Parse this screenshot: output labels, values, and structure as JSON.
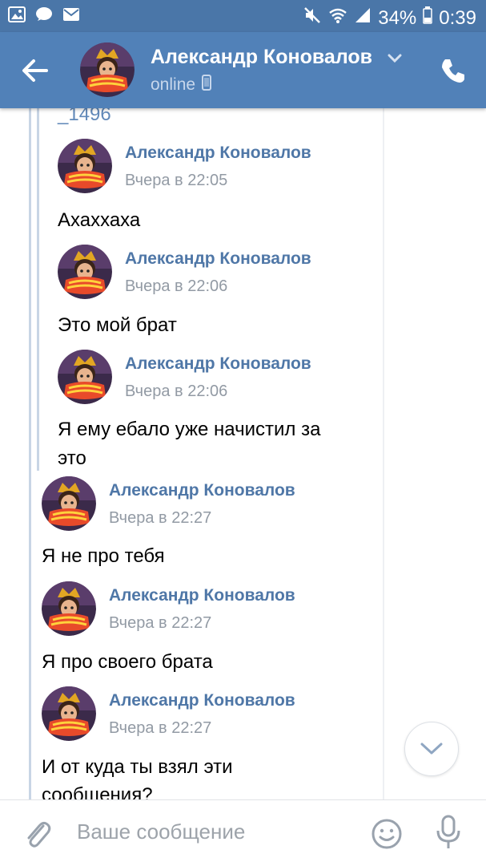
{
  "status_bar": {
    "battery": "34%",
    "time": "0:39",
    "icons": [
      "image-icon",
      "chat-bubble-icon",
      "mail-icon",
      "mute-icon",
      "wifi-icon",
      "signal-icon",
      "battery-icon"
    ]
  },
  "header": {
    "name": "Александр Коновалов",
    "status": "online",
    "icons": [
      "back-arrow-icon",
      "chevron-down-icon",
      "mobile-icon",
      "phone-icon"
    ]
  },
  "feed": {
    "truncated_text": "_1496",
    "messages": [
      {
        "sender": "Александр Коновалов",
        "time": "Вчера в 22:05",
        "text": "Ахаххаха"
      },
      {
        "sender": "Александр Коновалов",
        "time": "Вчера в 22:06",
        "text": "Это мой брат"
      },
      {
        "sender": "Александр Коновалов",
        "time": "Вчера в 22:06",
        "text_line1": "Я ему ебало уже начистил за",
        "text_line2": "это"
      },
      {
        "sender": "Александр Коновалов",
        "time": "Вчера в 22:27",
        "text": "Я не про тебя"
      },
      {
        "sender": "Александр Коновалов",
        "time": "Вчера в 22:27",
        "text": "Я про своего брата"
      },
      {
        "sender": "Александр Коновалов",
        "time": "Вчера в 22:27",
        "text_line1": "И от куда ты взял эти",
        "text_line2": "сообщения?"
      }
    ]
  },
  "input": {
    "placeholder": "Ваше сообщение"
  },
  "colors": {
    "header_bg": "#5181b8",
    "statusbar_bg": "#4a76a8",
    "sender_name": "#4f77a7",
    "timestamp": "#929aa4",
    "forward_bar": "#c8d5e5"
  }
}
